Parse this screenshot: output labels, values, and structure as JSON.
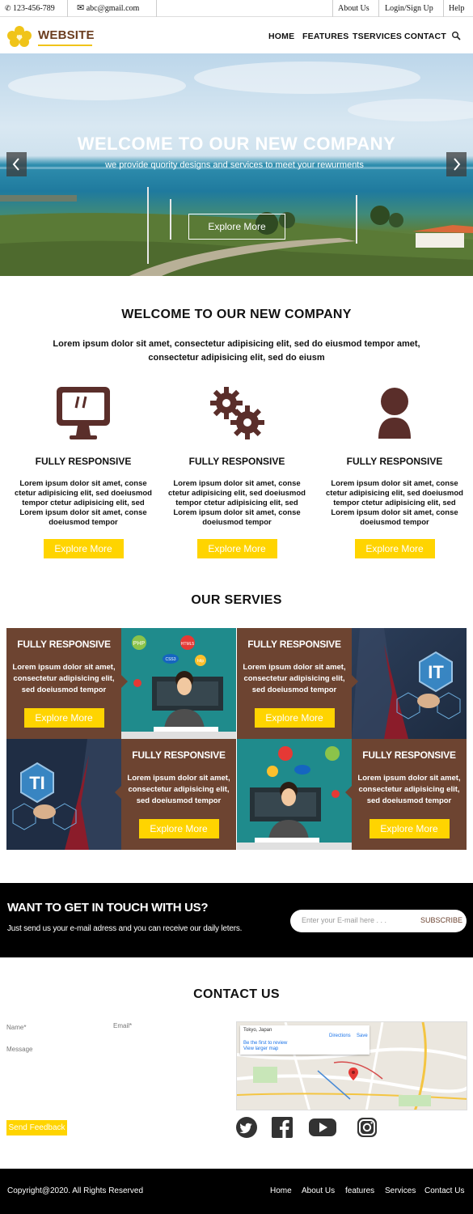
{
  "topbar": {
    "phone": "123-456-789",
    "email": "abc@gmail.com",
    "links": [
      "About Us",
      "Login/Sign Up",
      "Help"
    ]
  },
  "header": {
    "logo_text": "WEBSITE",
    "nav": [
      "HOME",
      "FEATURES",
      "TSERVICES",
      "CONTACT"
    ]
  },
  "hero": {
    "title": "WELCOME TO OUR NEW COMPANY",
    "subtitle": "we provide quority designs and services to meet your rewurments",
    "button": "Explore More"
  },
  "welcome": {
    "title": "WELCOME TO OUR NEW COMPANY",
    "text": "Lorem ipsum dolor sit amet, consectetur adipisicing elit, sed do eiusmod tempor amet, consectetur adipisicing elit, sed do eiusm"
  },
  "features": [
    {
      "icon": "monitor-icon",
      "title": "FULLY RESPONSIVE",
      "text": "Lorem ipsum dolor sit amet, conse ctetur adipisicing elit, sed doeiusmod tempor ctetur adipisicing elit, sed Lorem ipsum dolor sit amet, conse doeiusmod tempor",
      "button": "Explore More"
    },
    {
      "icon": "gears-icon",
      "title": "FULLY RESPONSIVE",
      "text": "Lorem ipsum dolor sit amet, conse ctetur adipisicing elit, sed doeiusmod tempor ctetur adipisicing elit, sed Lorem ipsum dolor sit amet, conse doeiusmod tempor",
      "button": "Explore More"
    },
    {
      "icon": "user-icon",
      "title": "FULLY RESPONSIVE",
      "text": "Lorem ipsum dolor sit amet, conse ctetur adipisicing elit, sed doeiusmod tempor ctetur adipisicing elit, sed Lorem ipsum dolor sit amet, conse doeiusmod tempor",
      "button": "Explore More"
    }
  ],
  "services": {
    "title": "OUR SERVIES",
    "cards": [
      {
        "title": "FULLY RESPONSIVE",
        "text": "Lorem ipsum dolor sit amet, consectetur adipisicing elit, sed doeiusmod tempor",
        "button": "Explore More"
      },
      {
        "title": "FULLY RESPONSIVE",
        "text": "Lorem ipsum dolor sit amet, consectetur adipisicing elit, sed doeiusmod tempor",
        "button": "Explore More"
      },
      {
        "title": "FULLY RESPONSIVE",
        "text": "Lorem ipsum dolor sit amet, consectetur adipisicing elit, sed doeiusmod tempor",
        "button": "Explore More"
      },
      {
        "title": "FULLY RESPONSIVE",
        "text": "Lorem ipsum dolor sit amet, consectetur adipisicing elit, sed doeiusmod tempor",
        "button": "Explore More"
      }
    ],
    "image_labels": {
      "it": "IT",
      "ti": "TI",
      "php": "PHP",
      "html5": "HTML5",
      "css3": "CSS3",
      "http": "http"
    }
  },
  "newsletter": {
    "title": "WANT TO GET IN TOUCH WITH US?",
    "subtitle": "Just send us your e-mail adress and you can receive our daily leters.",
    "placeholder": "Enter your E-mail here . . .",
    "button": "SUBSCRIBE"
  },
  "contact": {
    "title": "CONTACT US",
    "name_placeholder": "Name*",
    "email_placeholder": "Email*",
    "message_placeholder": "Message",
    "button": "Send Feedback",
    "map_place": "Tokyo, Japan",
    "map_directions": "Directions",
    "map_save": "Save",
    "map_review": "Be the first to review",
    "map_larger": "View larger map"
  },
  "social": [
    "twitter-icon",
    "facebook-icon",
    "youtube-icon",
    "instagram-icon"
  ],
  "footer": {
    "copyright": "Copyright@2020. All Rights Reserved",
    "links": [
      "Home",
      "About Us",
      "features",
      "Services",
      "Contact Us"
    ]
  },
  "colors": {
    "brand_brown": "#6d4431",
    "accent_yellow": "#ffd400",
    "icon_brown": "#5a2e2a"
  }
}
